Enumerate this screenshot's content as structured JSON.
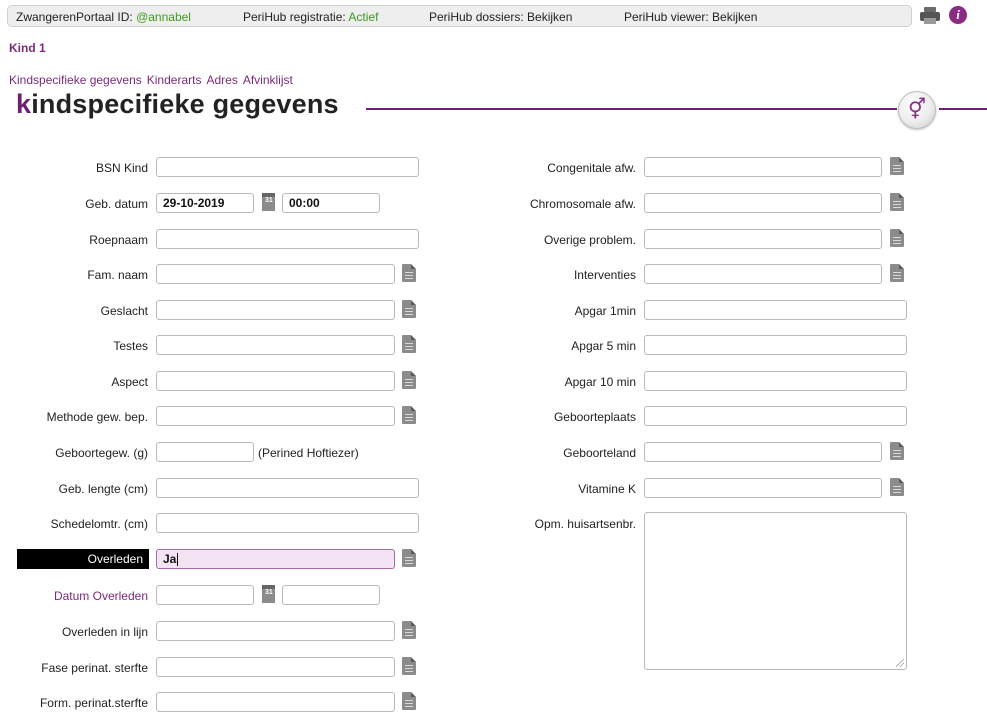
{
  "topbar": {
    "portal_label": "ZwangerenPortaal ID:",
    "portal_user": "@annabel",
    "registratie_label": "PeriHub registratie:",
    "registratie_status": "Actief",
    "dossiers": "PeriHub dossiers: Bekijken",
    "viewer": "PeriHub viewer: Bekijken"
  },
  "page": {
    "kind": "Kind 1",
    "tabs": [
      "Kindspecifieke gegevens",
      "Kinderarts",
      "Adres",
      "Afvinklijst"
    ],
    "heading_first": "k",
    "heading_rest": "indspecifieke gegevens",
    "gender_symbol": "⚥"
  },
  "left": {
    "bsn": {
      "label": "BSN Kind",
      "value": ""
    },
    "geb_datum": {
      "label": "Geb. datum",
      "date": "29-10-2019",
      "time": "00:00"
    },
    "roepnaam": {
      "label": "Roepnaam",
      "value": ""
    },
    "fam_naam": {
      "label": "Fam. naam",
      "value": ""
    },
    "geslacht": {
      "label": "Geslacht",
      "value": ""
    },
    "testes": {
      "label": "Testes",
      "value": ""
    },
    "aspect": {
      "label": "Aspect",
      "value": ""
    },
    "methode": {
      "label": "Methode gew. bep.",
      "value": ""
    },
    "geboortegew": {
      "label": "Geboortegew. (g)",
      "value": "",
      "note": "(Perined Hoftiezer)"
    },
    "lengte": {
      "label": "Geb. lengte (cm)",
      "value": ""
    },
    "schedel": {
      "label": "Schedelomtr. (cm)",
      "value": ""
    },
    "overleden": {
      "label": "Overleden",
      "value": "Ja"
    },
    "datum_overleden": {
      "label": "Datum Overleden",
      "date": "",
      "time": ""
    },
    "overleden_lijn": {
      "label": "Overleden in lijn",
      "value": ""
    },
    "fase": {
      "label": "Fase perinat. sterfte",
      "value": ""
    },
    "form": {
      "label": "Form. perinat.sterfte",
      "value": ""
    }
  },
  "right": {
    "congenitale": {
      "label": "Congenitale afw.",
      "value": ""
    },
    "chromosomale": {
      "label": "Chromosomale afw.",
      "value": ""
    },
    "overige": {
      "label": "Overige problem.",
      "value": ""
    },
    "interventies": {
      "label": "Interventies",
      "value": ""
    },
    "apgar1": {
      "label": "Apgar 1min",
      "value": ""
    },
    "apgar5": {
      "label": "Apgar 5 min",
      "value": ""
    },
    "apgar10": {
      "label": "Apgar 10 min",
      "value": ""
    },
    "geboorteplaats": {
      "label": "Geboorteplaats",
      "value": ""
    },
    "geboorteland": {
      "label": "Geboorteland",
      "value": ""
    },
    "vitamine_k": {
      "label": "Vitamine K",
      "value": ""
    },
    "opm": {
      "label": "Opm. huisartsenbr.",
      "value": ""
    }
  }
}
